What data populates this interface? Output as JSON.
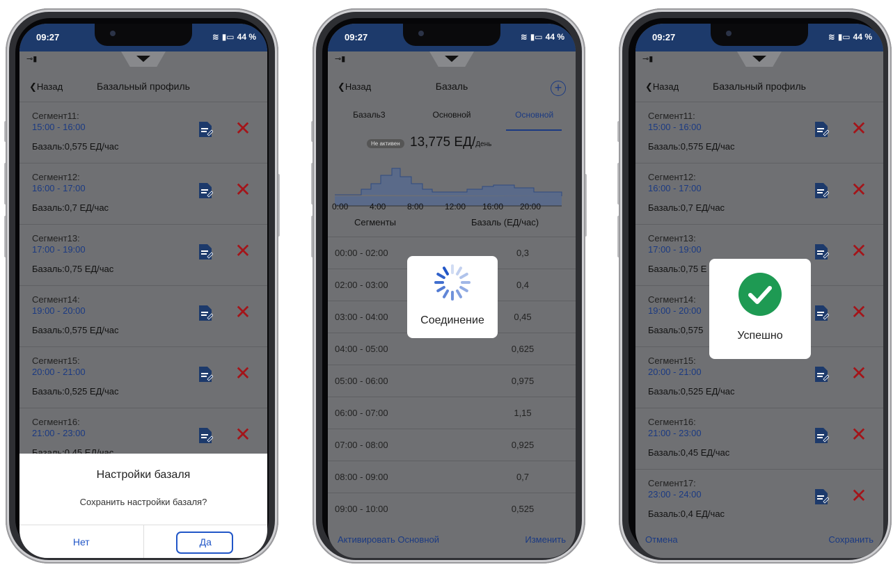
{
  "colors": {
    "accent": "#2156c7",
    "status_bar": "#1d3a6b",
    "delete": "#a41419",
    "success": "#1e9a53",
    "overlay": "#6f7073"
  },
  "status": {
    "time": "09:27",
    "battery": "44 %"
  },
  "phone1": {
    "back": "Назад",
    "title": "Базальный профиль",
    "segments": [
      {
        "name": "Сегмент11:",
        "time": "15:00 - 16:00",
        "basal": "Базаль:0,575 ЕД/час"
      },
      {
        "name": "Сегмент12:",
        "time": "16:00 - 17:00",
        "basal": "Базаль:0,7 ЕД/час"
      },
      {
        "name": "Сегмент13:",
        "time": "17:00 - 19:00",
        "basal": "Базаль:0,75 ЕД/час"
      },
      {
        "name": "Сегмент14:",
        "time": "19:00 - 20:00",
        "basal": "Базаль:0,575 ЕД/час"
      },
      {
        "name": "Сегмент15:",
        "time": "20:00 - 21:00",
        "basal": "Базаль:0,525 ЕД/час"
      },
      {
        "name": "Сегмент16:",
        "time": "21:00 - 23:00",
        "basal": "Базаль:0,45 ЕД/час"
      }
    ],
    "dialog": {
      "title": "Настройки базаля",
      "message": "Сохранить настройки базаля?",
      "no": "Нет",
      "yes": "Да"
    }
  },
  "phone2": {
    "back": "Назад",
    "title": "Базаль",
    "tabs": [
      "Базаль3",
      "Основной",
      "Основной"
    ],
    "status_badge": "Не активен",
    "daily_value": "13,775",
    "daily_unit": "ЕД/",
    "daily_suffix": "День",
    "chart_ticks": [
      "0:00",
      "4:00",
      "8:00",
      "12:00",
      "16:00",
      "20:00"
    ],
    "col_segments": "Сегменты",
    "col_basal": "Базаль (ЕД/час)",
    "rows": [
      {
        "time": "00:00 - 02:00",
        "value": "0,3"
      },
      {
        "time": "02:00 - 03:00",
        "value": "0,4"
      },
      {
        "time": "03:00 - 04:00",
        "value": "0,45"
      },
      {
        "time": "04:00 - 05:00",
        "value": "0,625"
      },
      {
        "time": "05:00 - 06:00",
        "value": "0,975"
      },
      {
        "time": "06:00 - 07:00",
        "value": "1,15"
      },
      {
        "time": "07:00 - 08:00",
        "value": "0,925"
      },
      {
        "time": "08:00 - 09:00",
        "value": "0,7"
      },
      {
        "time": "09:00 - 10:00",
        "value": "0,525"
      }
    ],
    "activate": "Активировать Основной",
    "change": "Изменить",
    "loading": "Соединение"
  },
  "phone3": {
    "back": "Назад",
    "title": "Базальный профиль",
    "segments": [
      {
        "name": "Сегмент11:",
        "time": "15:00 - 16:00",
        "basal": "Базаль:0,575 ЕД/час"
      },
      {
        "name": "Сегмент12:",
        "time": "16:00 - 17:00",
        "basal": "Базаль:0,7 ЕД/час"
      },
      {
        "name": "Сегмент13:",
        "time": "17:00 - 19:00",
        "basal": "Базаль:0,75 Е"
      },
      {
        "name": "Сегмент14:",
        "time": "19:00 - 20:00",
        "basal": "Базаль:0,575"
      },
      {
        "name": "Сегмент15:",
        "time": "20:00 - 21:00",
        "basal": "Базаль:0,525 ЕД/час"
      },
      {
        "name": "Сегмент16:",
        "time": "21:00 - 23:00",
        "basal": "Базаль:0,45 ЕД/час"
      },
      {
        "name": "Сегмент17:",
        "time": "23:00 - 24:00",
        "basal": "Базаль:0,4 ЕД/час"
      }
    ],
    "cancel": "Отмена",
    "save": "Сохранить",
    "success": "Успешно"
  }
}
